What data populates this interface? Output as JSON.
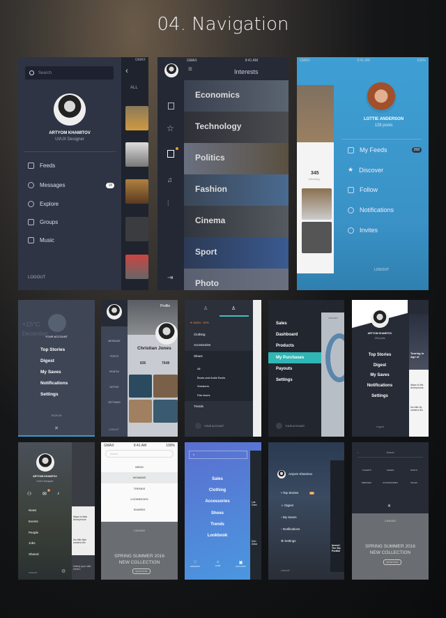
{
  "title": "04. Navigation",
  "s1": {
    "search_placeholder": "Search",
    "name": "ARTYOM KHAMITOV",
    "role": "UI/UX Designer",
    "menu": [
      {
        "label": "Feeds",
        "icon": "lightbulb-icon"
      },
      {
        "label": "Messages",
        "icon": "chat-bubble-icon"
      },
      {
        "label": "Explore",
        "icon": "globe-icon"
      },
      {
        "label": "Groups",
        "icon": "users-icon"
      },
      {
        "label": "Music",
        "icon": "music-note-icon"
      }
    ],
    "messages_badge": "18",
    "logout": "LOGOUT",
    "peek_carrier": "GMAX",
    "peek_tab": "ALL"
  },
  "s2": {
    "carrier": "GMAX",
    "time": "9:41 AM",
    "header": "Interests",
    "categories": [
      "Economics",
      "Technology",
      "Politics",
      "Fashion",
      "Cinema",
      "Sport",
      "Photo"
    ],
    "side_icons": [
      "book-icon",
      "star-icon",
      "bookmark-icon",
      "bell-icon",
      "sliders-icon",
      "logout-icon"
    ],
    "accent": "#f0a030"
  },
  "s3": {
    "carrier": "GMAX",
    "time": "9:41 AM",
    "battery": "100%",
    "name": "LOTTIE ANDERSON",
    "posts": "128 posts",
    "menu": [
      "My Feeds",
      "Discover",
      "Follow",
      "Notifications",
      "Invites"
    ],
    "feeds_badge": "268",
    "logout": "LOGOUT",
    "peek_stat": "345",
    "peek_stat_label": "following",
    "bg": "#3d9bd0"
  },
  "r2a": {
    "account": "YOUR ACCOUNT",
    "items": [
      "Top Stories",
      "Digest",
      "My Saves",
      "Notifications",
      "Settings"
    ],
    "sign_in": "SIGN IN",
    "weather": "+15°C",
    "date": "December"
  },
  "r2b": {
    "header": "Profile",
    "side": [
      "MESSAGE",
      "POSTS",
      "PEOPLE",
      "NOTICE",
      "SETTINGS"
    ],
    "logout": "LOGOUT",
    "name": "Christian Jones",
    "stats": [
      "836",
      "7648"
    ]
  },
  "r2c": {
    "items": [
      "Sales -15%",
      "Clothing",
      "Accessories",
      "Shoes"
    ],
    "sub": [
      "All",
      "Boots and Ankle Boots",
      "Sneakers",
      "Flat shoes"
    ],
    "trends": "Trends",
    "account": "YOUR ACCOUNT",
    "accent": "#e07a3a",
    "tab_accent": "#3fc1c0"
  },
  "r2d": {
    "items": [
      "Sales",
      "Dashboard",
      "Products",
      "My Purchases",
      "Payouts",
      "Settings"
    ],
    "active": "My Purchases",
    "account": "YOUR ACCOUNT",
    "peek_month": "JANUARY",
    "accent": "#2fb6b5"
  },
  "r2e": {
    "name": "ARTYOM KHAMITOV",
    "posts": "128 posts",
    "items": [
      "Top Stories",
      "Digest",
      "My Saves",
      "Notifications",
      "Settings"
    ],
    "logout": "Logout",
    "peek": [
      "Touring in Age of",
      "Ways to Ma Anonymous",
      "No-frills fly camera dro"
    ]
  },
  "r3a": {
    "name": "ARTYOM KHAMITOV",
    "role": "UI/UX Designer",
    "items": [
      "News",
      "Events",
      "People",
      "Jobs",
      "Shared"
    ],
    "logout": "LOGOUT",
    "notif_badge": "3",
    "peek": [
      "Ways to Mak Anonymous",
      "No-frills flyin camera dro",
      "Satisfy your with electro"
    ]
  },
  "r3b": {
    "carrier": "GMAX",
    "time": "9:41 AM",
    "battery": "100%",
    "search_placeholder": "Search",
    "items": [
      "MENS",
      "WOMANS",
      "TRENDS",
      "LOOKBOOKS",
      "SHARED"
    ],
    "active": "WOMANS",
    "brand": "CANVAS",
    "hero1": "SPRING SUMMER 2016",
    "hero2": "NEW COLLECTION",
    "cta": "SHOW NOW"
  },
  "r3c": {
    "items": [
      "Sales",
      "Clothing",
      "Accessories",
      "Shoes",
      "Trends",
      "Lookbook"
    ],
    "bottom": [
      "WISHLIST",
      "CART",
      "ACCOUNT"
    ],
    "search_placeholder": "Search",
    "peek": [
      "Las Gam",
      "Don Adsa"
    ]
  },
  "r3d": {
    "name": "Artyom Khamitov",
    "items": [
      "Top Stories",
      "Digest",
      "My Saves",
      "Notifications",
      "Settings"
    ],
    "badge": "24",
    "logout": "LOGOUT",
    "peek": "Invest i The Ste Portfoli"
  },
  "r3e": {
    "search_placeholder": "Search",
    "categories": [
      "T-SHIRTS",
      "SHOES",
      "PANTS",
      "DRESSES",
      "ACCESSORIES",
      "SALES"
    ],
    "brand": "CANVAS",
    "hero1": "SPRING SUMMER 2016",
    "hero2": "NEW COLLECTION",
    "cta": "SHOW NOW"
  }
}
